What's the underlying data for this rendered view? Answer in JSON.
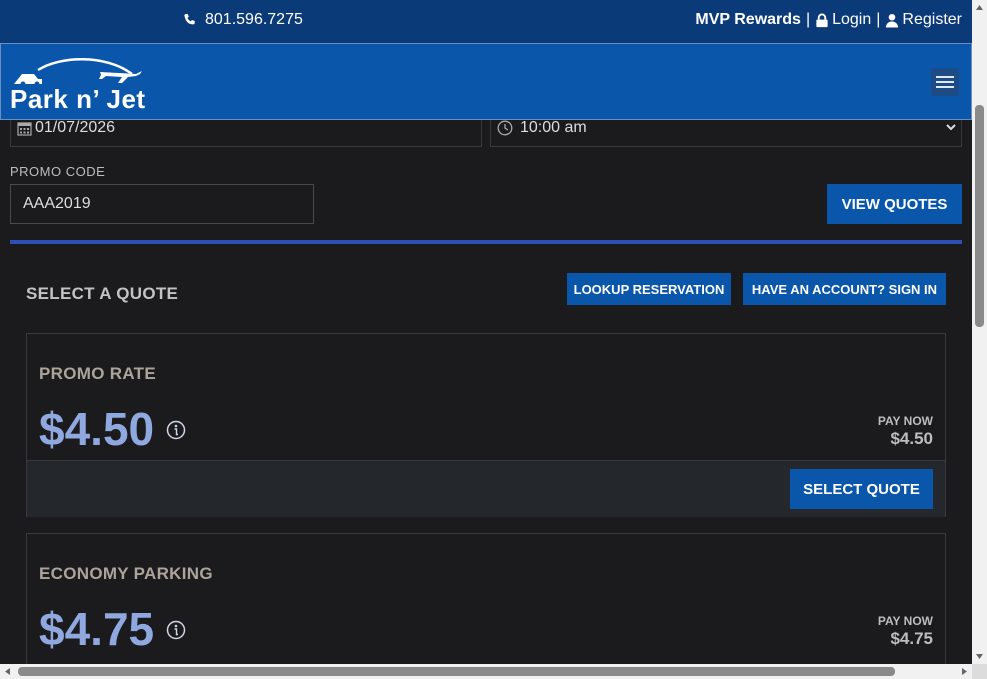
{
  "topbar": {
    "phone": "801.596.7275",
    "mvp_rewards": "MVP Rewards",
    "separator": "|",
    "login": "Login",
    "register": "Register"
  },
  "header": {
    "logo_text": "Park n’ Jet"
  },
  "form": {
    "date_value": "01/07/2026",
    "time_value": "10:00 am",
    "promo_label": "PROMO CODE",
    "promo_value": "AAA2019",
    "view_quotes": "VIEW QUOTES"
  },
  "quotes": {
    "heading": "SELECT A QUOTE",
    "lookup": "LOOKUP RESERVATION",
    "signin": "HAVE AN ACCOUNT? SIGN IN",
    "cards": [
      {
        "name": "PROMO RATE",
        "price": "$4.50",
        "pay_now_label": "PAY NOW",
        "pay_now_value": "$4.50",
        "select": "SELECT QUOTE"
      },
      {
        "name": "ECONOMY PARKING",
        "price": "$4.75",
        "pay_now_label": "PAY NOW",
        "pay_now_value": "$4.75"
      }
    ]
  },
  "colors": {
    "topbar": "#0b3a78",
    "header": "#0a56ab",
    "accent_divider": "#2e4fb6",
    "price": "#8fa8e0"
  }
}
